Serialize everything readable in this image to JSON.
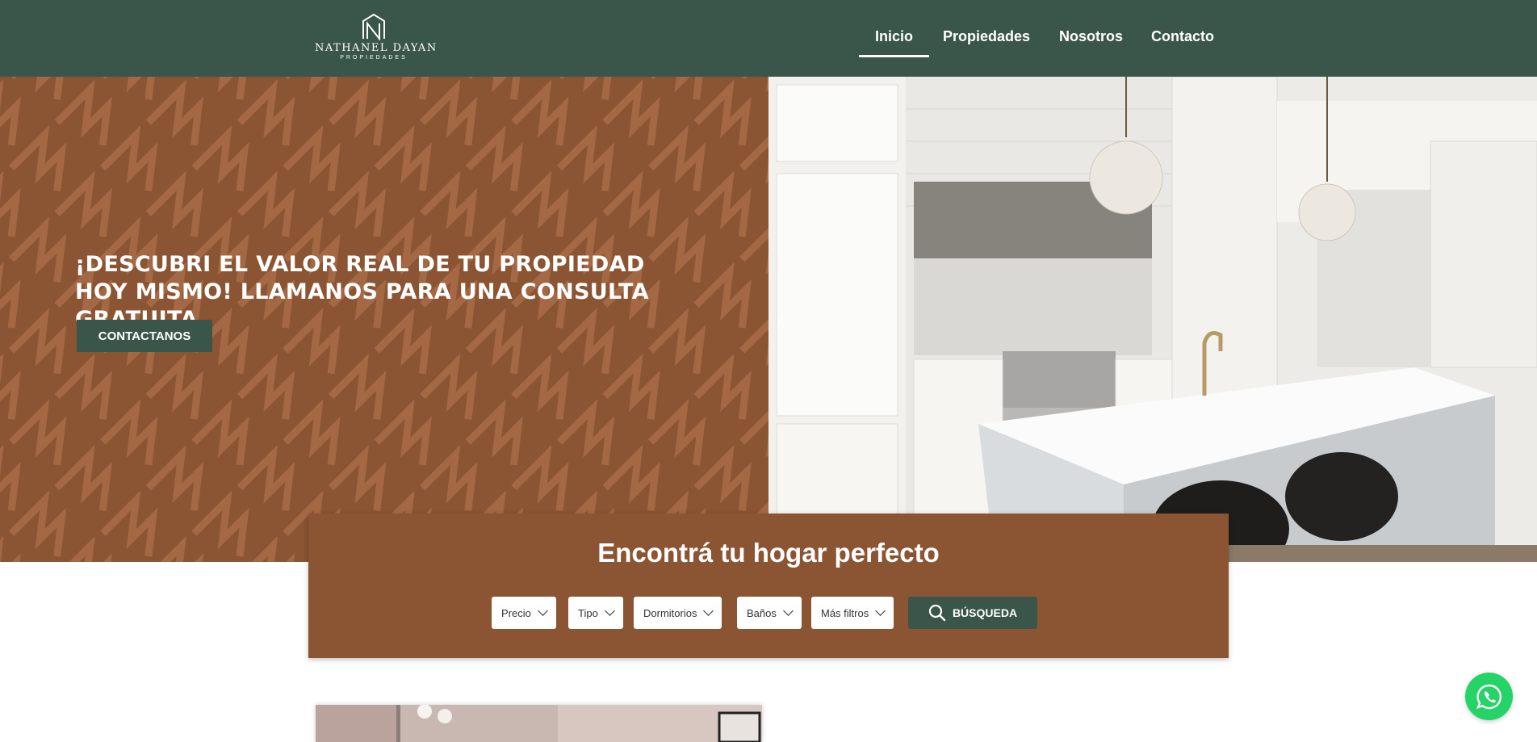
{
  "header": {
    "logo_name": "NATHANEL DAYAN",
    "logo_sub": "PROPIEDADES",
    "nav": [
      {
        "label": "Inicio",
        "active": true
      },
      {
        "label": "Propiedades",
        "active": false
      },
      {
        "label": "Nosotros",
        "active": false
      },
      {
        "label": "Contacto",
        "active": false
      }
    ]
  },
  "hero": {
    "title": "¡Descubri el valor real de tu propiedad hoy mismo! Llamanos para una consulta gratuita",
    "cta_label": "CONTACTANOS",
    "prev_arrow": "‹"
  },
  "search": {
    "title": "Encontrá tu hogar perfecto",
    "filters": [
      "Precio",
      "Tipo",
      "Dormitorios",
      "Baños",
      "Más filtros"
    ],
    "button_label": "BÚSQUEDA"
  },
  "icons": {
    "search": "search-icon",
    "whatsapp": "whatsapp-icon",
    "chevron": "chevron-down-icon"
  },
  "colors": {
    "header_bg": "#3a554a",
    "brand_brown": "#8b5433",
    "whatsapp_green": "#25d366"
  }
}
